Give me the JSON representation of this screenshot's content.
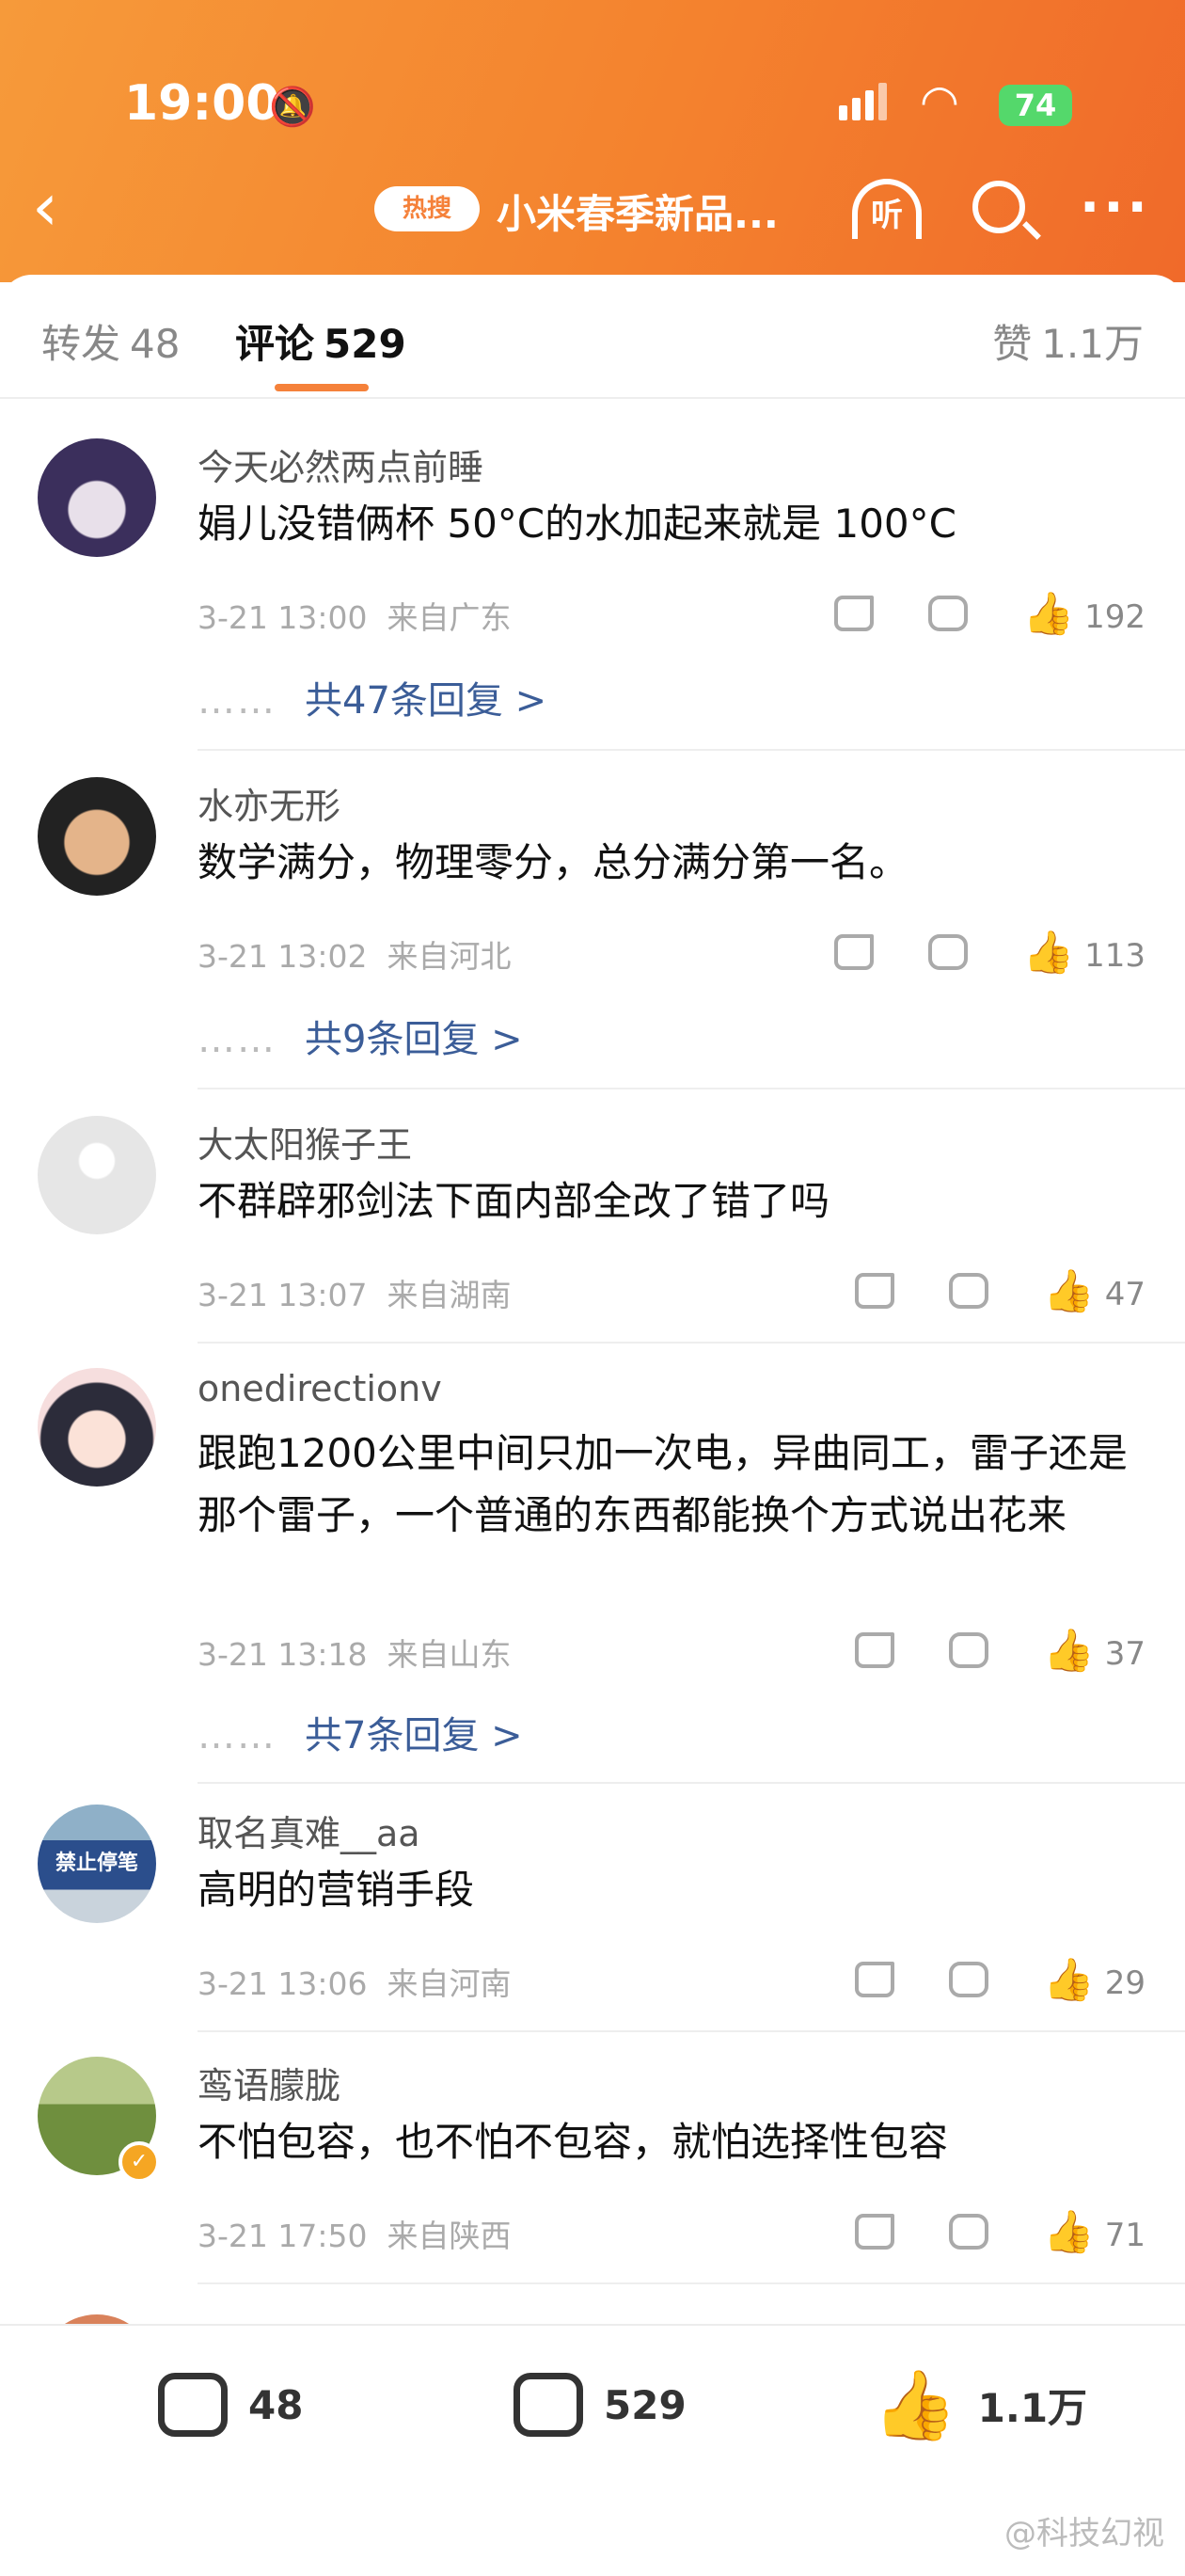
{
  "status_bar": {
    "time": "19:00",
    "battery": "74"
  },
  "nav": {
    "badge": "热搜",
    "title": "小米春季新品...",
    "listen": "听"
  },
  "tabs": {
    "repost_label": "转发",
    "repost_count": "48",
    "comment_label": "评论",
    "comment_count": "529",
    "like_label": "赞",
    "like_count": "1.1万"
  },
  "comments": [
    {
      "name": "今天必然两点前睡",
      "text": "娟儿没错俩杯 50°C的水加起来就是 100°C",
      "time": "3-21 13:00",
      "location": "来自广东",
      "likes": "192",
      "replies": "共47条回复 >"
    },
    {
      "name": "水亦无形",
      "text": "数学满分，物理零分，总分满分第一名。",
      "time": "3-21 13:02",
      "location": "来自河北",
      "likes": "113",
      "replies": "共9条回复 >"
    },
    {
      "name": "大太阳猴子王",
      "text": "不群辟邪剑法下面内部全改了错了吗",
      "time": "3-21 13:07",
      "location": "来自湖南",
      "likes": "47"
    },
    {
      "name": "onedirectionv",
      "text": "跟跑1200公里中间只加一次电，异曲同工，雷子还是那个雷子，一个普通的东西都能换个方式说出花来",
      "time": "3-21 13:18",
      "location": "来自山东",
      "likes": "37",
      "replies": "共7条回复 >"
    },
    {
      "name": "取名真难__aa",
      "text": "高明的营销手段",
      "time": "3-21 13:06",
      "location": "来自河南",
      "likes": "29"
    },
    {
      "name": "鸾语朦胧",
      "text": "不怕包容，也不怕不包容，就怕选择性包容",
      "time": "3-21 17:50",
      "location": "来自陕西",
      "likes": "71"
    }
  ],
  "avatar5_text": "禁止停笔",
  "bottom_bar": {
    "repost": "48",
    "comment": "529",
    "like": "1.1万"
  },
  "watermark": "@科技幻视",
  "colors": {
    "header": "#f4822e",
    "accent": "#f5813a",
    "link": "#3b5d98"
  }
}
